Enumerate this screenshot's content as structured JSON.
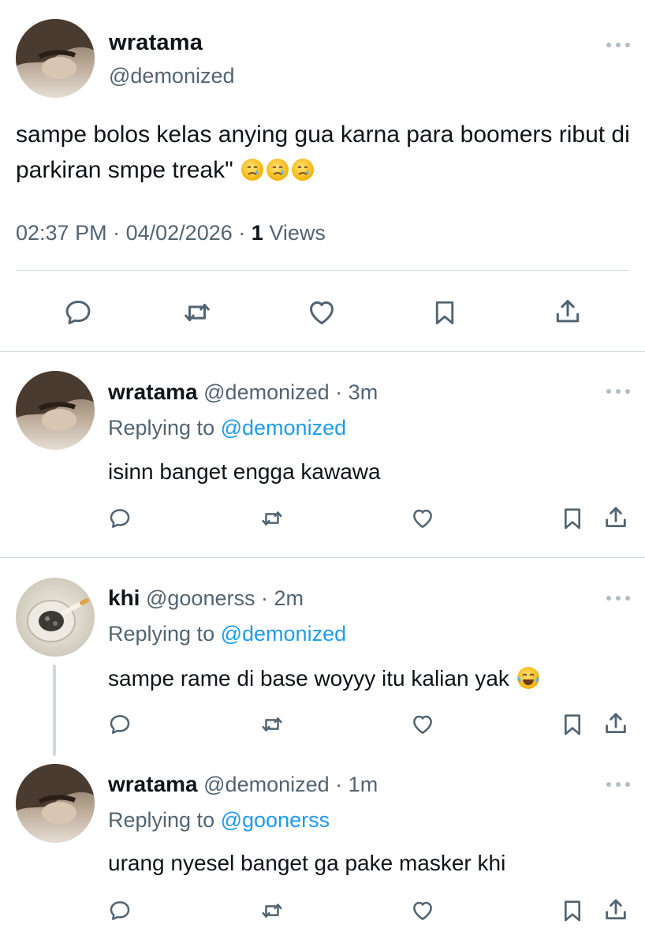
{
  "main_tweet": {
    "name": "wratama",
    "handle": "@demonized",
    "text": "sampe bolos kelas anying gua karna para boomers ribut di parkiran smpe treak\"",
    "emojis": [
      "crying-face",
      "crying-face",
      "crying-face"
    ],
    "time": "02:37 PM",
    "date": "04/02/2026",
    "views_count": "1",
    "views_label": "Views",
    "actions": [
      "reply-icon",
      "retweet-icon",
      "like-icon",
      "bookmark-icon",
      "share-icon"
    ]
  },
  "replies": [
    {
      "name": "wratama",
      "handle": "@demonized",
      "time": "3m",
      "replying_label": "Replying to",
      "replying_to": "@demonized",
      "text": "isinn banget engga kawawa"
    },
    {
      "name": "khi",
      "handle": "@goonerss",
      "time": "2m",
      "replying_label": "Replying to",
      "replying_to": "@demonized",
      "text": "sampe rame di base woyyy itu kalian yak",
      "emoji": "face-with-tears-of-joy"
    },
    {
      "name": "wratama",
      "handle": "@demonized",
      "time": "1m",
      "replying_label": "Replying to",
      "replying_to": "@goonerss",
      "text": "urang nyesel banget ga pake masker khi"
    }
  ],
  "separator": "·",
  "colors": {
    "text": "#0f1419",
    "muted": "#536471",
    "link": "#1d9bf0",
    "divider": "#d4d9dd"
  }
}
